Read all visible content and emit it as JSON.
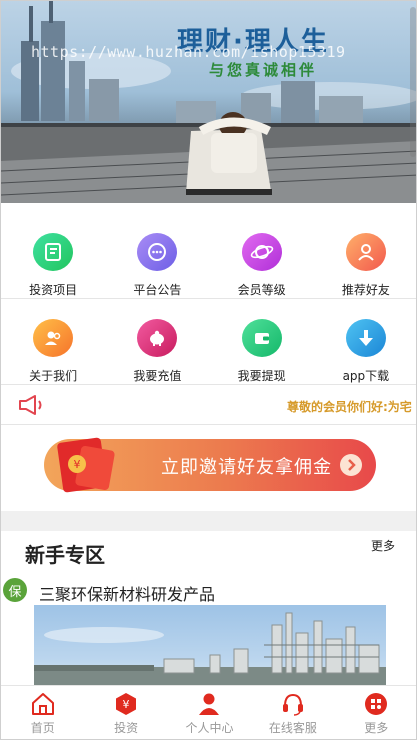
{
  "banner": {
    "title": "理财·理人生",
    "subtitle": "与您真诚相伴",
    "watermark": "https://www.huzhan.com/ishop15319"
  },
  "grid": [
    {
      "label": "投资项目",
      "icon": "document-icon",
      "color_from": "#3ee0a0",
      "color_to": "#22c55e"
    },
    {
      "label": "平台公告",
      "icon": "chat-bubble-icon",
      "color_from": "#a98cf5",
      "color_to": "#6d5fe6"
    },
    {
      "label": "会员等级",
      "icon": "planet-icon",
      "color_from": "#e16af0",
      "color_to": "#b02fd8"
    },
    {
      "label": "推荐好友",
      "icon": "user-badge-icon",
      "color_from": "#ffb06a",
      "color_to": "#f2584d"
    },
    {
      "label": "关于我们",
      "icon": "users-icon",
      "color_from": "#ffc048",
      "color_to": "#f6732b"
    },
    {
      "label": "我要充值",
      "icon": "piggy-bank-icon",
      "color_from": "#f25aa0",
      "color_to": "#c81c5e"
    },
    {
      "label": "我要提现",
      "icon": "wallet-icon",
      "color_from": "#4fe09a",
      "color_to": "#15b86a"
    },
    {
      "label": "app下载",
      "icon": "download-icon",
      "color_from": "#4fc3f2",
      "color_to": "#1b86d6"
    }
  ],
  "notice": {
    "text": "尊敬的会员你们好:为宅"
  },
  "invite": {
    "text": "立即邀请好友拿佣金"
  },
  "section": {
    "title": "新手专区",
    "more": "更多"
  },
  "product": {
    "badge": "保",
    "title": "三聚环保新材料研发产品"
  },
  "tabs": [
    {
      "label": "首页",
      "icon": "home-icon"
    },
    {
      "label": "投资",
      "icon": "yen-icon"
    },
    {
      "label": "个人中心",
      "icon": "person-icon"
    },
    {
      "label": "在线客服",
      "icon": "headset-icon"
    },
    {
      "label": "更多",
      "icon": "more-icon"
    }
  ],
  "colors": {
    "accent_red": "#e02a1f",
    "notice_gold": "#d69a2a",
    "badge_green": "#5aa33a"
  }
}
